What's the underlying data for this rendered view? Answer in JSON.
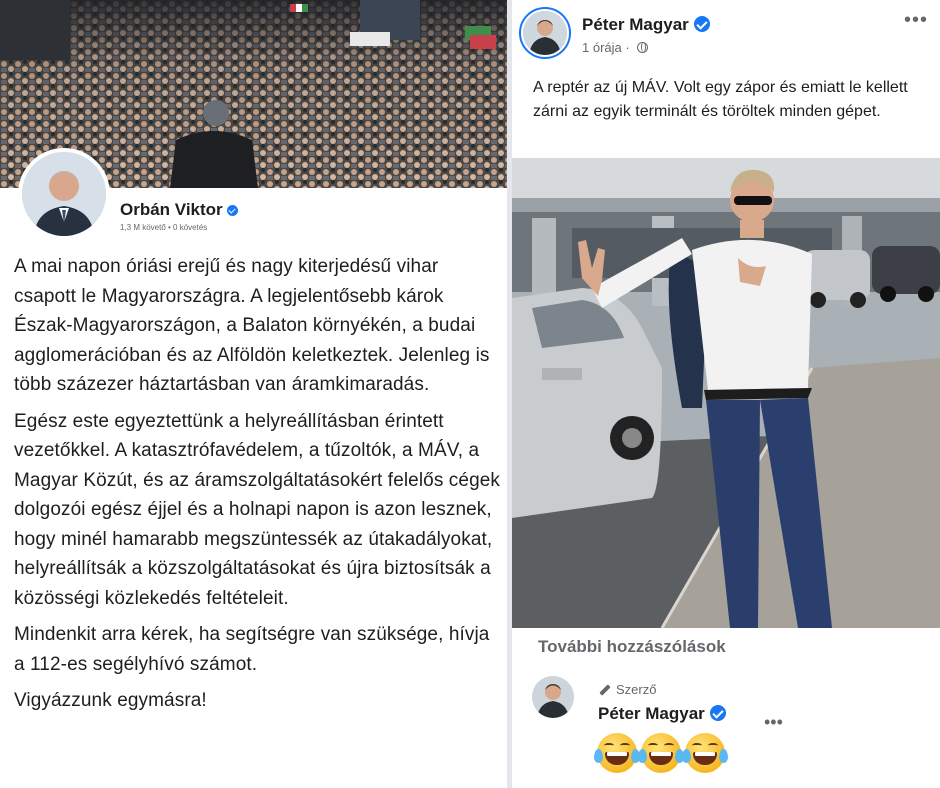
{
  "left_post": {
    "author_name": "Orbán Viktor",
    "author_meta": "1,3 M követő • 0 követés",
    "paragraphs": [
      "A mai napon óriási erejű és nagy kiterjedésű vihar csapott le Magyarországra. A legjelentősebb károk Észak-Magyarországon, a Balaton környékén, a budai agglomerációban és az Alföldön keletkeztek. Jelenleg is több százezer háztartásban van áramkimaradás.",
      "Egész este egyeztettünk a helyreállításban érintett vezetőkkel. A katasztrófavédelem, a tűzoltók, a MÁV, a Magyar Közút, és az áramszolgáltatásokért felelős cégek dolgozói egész éjjel és a holnapi napon is azon lesznek, hogy minél hamarabb megszüntessék az útakadályokat, helyreállítsák a közszolgáltatásokat és újra biztosítsák a közösségi közlekedés feltételeit.",
      "Mindenkit arra kérek, ha segítségre van szüksége, hívja a 112-es segélyhívó számot.",
      "Vigyázzunk egymásra!"
    ]
  },
  "right_post": {
    "author_name": "Péter Magyar",
    "time": "1 órája",
    "privacy_icon": "globe-icon",
    "more_icon": "more-options-icon",
    "text": "A reptér az új MÁV. Volt egy zápor és emiatt le kellett zárni az egyik terminált és töröltek minden gépet.",
    "more_comments_label": "További hozzászólások",
    "comment": {
      "badge": "Szerző",
      "author_name": "Péter Magyar",
      "emojis": [
        "😂",
        "😂",
        "😂"
      ]
    }
  },
  "colors": {
    "verified": "#1877f2",
    "text_primary": "#1c1e21",
    "text_secondary": "#65676b"
  }
}
